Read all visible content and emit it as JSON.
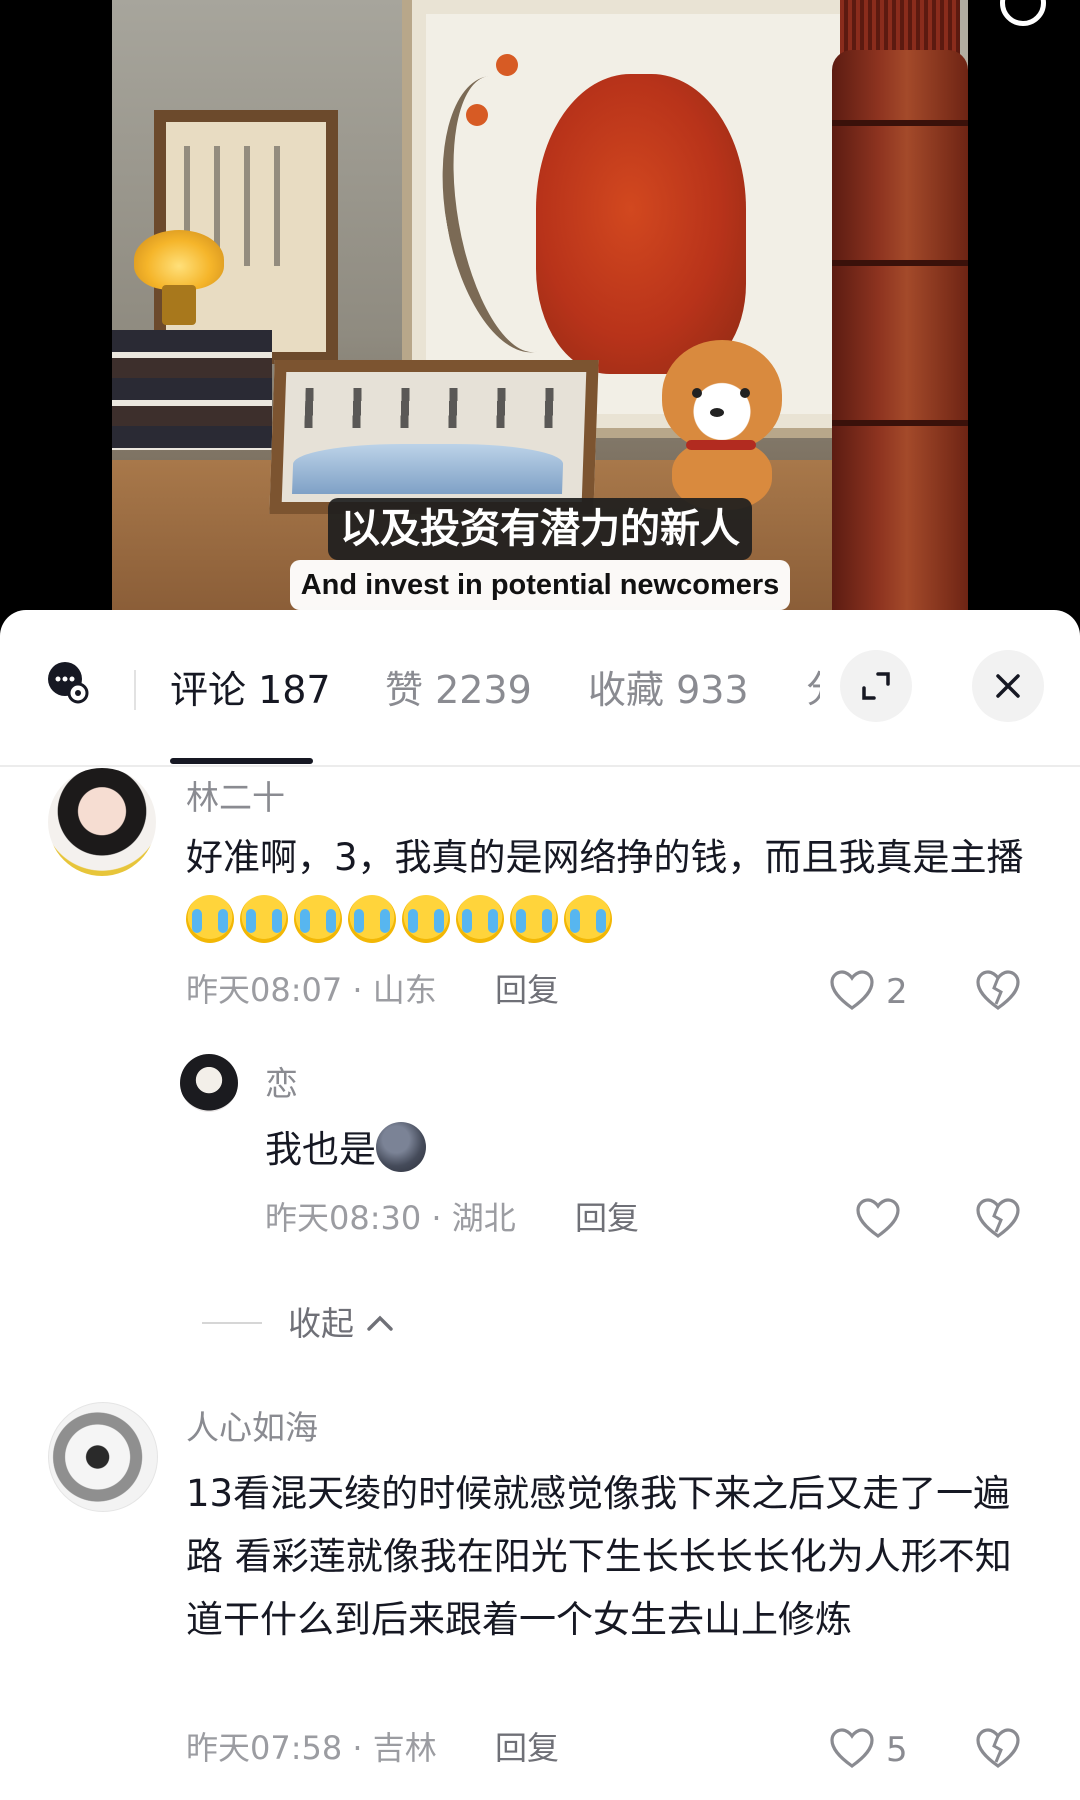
{
  "video": {
    "subtitle_cn": "以及投资有潜力的新人",
    "subtitle_en": "And invest in potential newcomers"
  },
  "comments_panel": {
    "tabs": [
      {
        "label": "评论 187",
        "active": true
      },
      {
        "label": "赞 2239",
        "active": false
      },
      {
        "label": "收藏 933",
        "active": false
      }
    ],
    "partial_tab": "分",
    "expand_icon": "expand-icon",
    "close_icon": "close-icon"
  },
  "comments": [
    {
      "username": "林二十",
      "text": "好准啊，3，我真的是网络挣的钱，而且我真是主播",
      "emoji": "crying-face",
      "emoji_count": 8,
      "time": "昨天08:07",
      "location": "山东",
      "reply_label": "回复",
      "likes": "2"
    },
    {
      "username": "恋",
      "text": "我也是",
      "emoji": "moon-face",
      "time": "昨天08:30",
      "location": "湖北",
      "reply_label": "回复",
      "likes": ""
    },
    {
      "username": "人心如海",
      "text": "13看混天绫的时候就感觉像我下来之后又走了一遍路 看彩莲就像我在阳光下生长长长长化为人形不知道干什么到后来跟着一个女生去山上修炼",
      "time": "昨天07:58",
      "location": "吉林",
      "reply_label": "回复",
      "likes": "5"
    }
  ],
  "collapse_label": "收起",
  "separator": "·"
}
